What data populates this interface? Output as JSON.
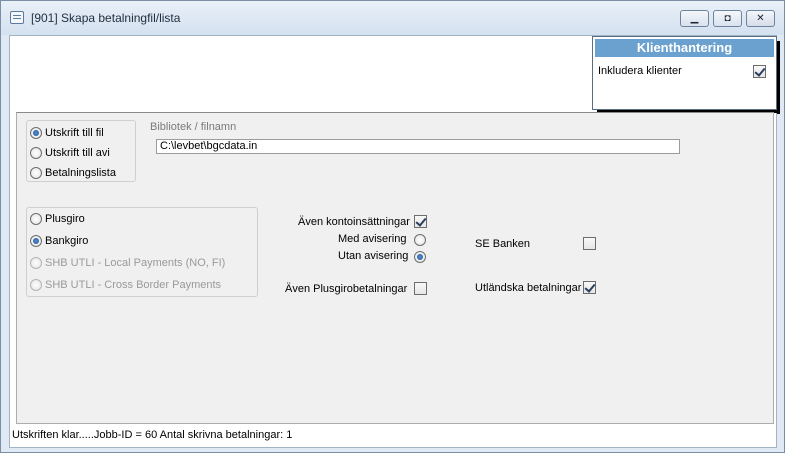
{
  "window": {
    "title": "[901]  Skapa betalningfil/lista"
  },
  "klient": {
    "header": "Klienthantering",
    "include_label": "Inkludera klienter",
    "include_checked": true
  },
  "output": {
    "options": [
      "Utskrift till fil",
      "Utskrift till avi",
      "Betalningslista"
    ],
    "selected": 0
  },
  "library": {
    "label": "Bibliotek / filnamn",
    "value": "C:\\levbet\\bgcdata.in"
  },
  "paytype": {
    "options": [
      "Plusgiro",
      "Bankgiro",
      "SHB UTLI - Local Payments (NO, FI)",
      "SHB UTLI - Cross Border Payments"
    ],
    "selected": 1,
    "disabled": [
      2,
      3
    ]
  },
  "options": {
    "konto_label": "Även kontoinsättningar",
    "konto_checked": true,
    "med_avisering": "Med avisering",
    "utan_avisering": "Utan avisering",
    "avisering_selected": "utan",
    "se_banken": "SE Banken",
    "se_banken_checked": false,
    "plusgiro_label": "Även Plusgirobetalningar",
    "plusgiro_checked": false,
    "utlandska_label": "Utländska betalningar",
    "utlandska_checked": true
  },
  "status": "Utskriften klar.....Jobb-ID = 60 Antal skrivna betalningar: 1"
}
